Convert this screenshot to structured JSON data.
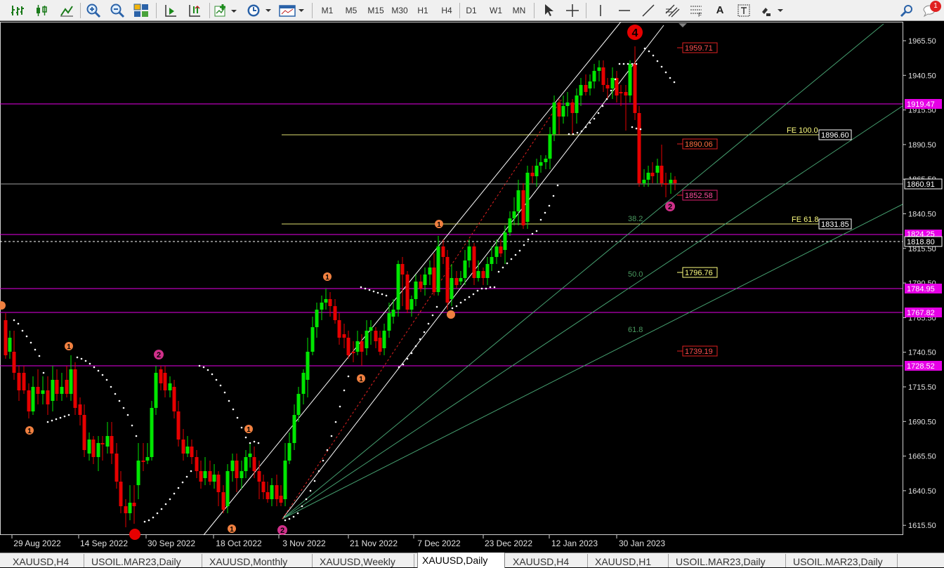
{
  "toolbar": {
    "timeframes": [
      "M1",
      "M5",
      "M15",
      "M30",
      "H1",
      "H4",
      "D1",
      "W1",
      "MN"
    ],
    "tools": {
      "bar_chart": "bar-chart-icon",
      "candle_chart": "candlestick-icon",
      "line_chart": "line-chart-icon",
      "zoom_in": "zoom-in-icon",
      "zoom_out": "zoom-out-icon",
      "tile": "tile-windows-icon",
      "autoscroll": "autoscroll-icon",
      "shift": "chart-shift-icon",
      "new_indicator": "indicator-icon",
      "periods": "clock-icon",
      "templates": "template-icon",
      "cursor": "cursor-icon",
      "crosshair": "crosshair-icon",
      "vline": "vertical-line-icon",
      "hline": "horizontal-line-icon",
      "trendline": "trendline-icon",
      "channel": "channel-icon",
      "fibo": "fibonacci-icon",
      "text": "text-icon",
      "label": "text-label-icon",
      "arrows": "arrows-icon",
      "search": "search-icon",
      "notifications": "notifications-icon"
    },
    "text_tool": "A",
    "notification_count": "1"
  },
  "chart": {
    "wave_top_label": "4",
    "price_ticks": [
      "1965.50",
      "1940.50",
      "1915.50",
      "1890.50",
      "1865.50",
      "1840.50",
      "1815.50",
      "1790.50",
      "1765.50",
      "1740.50",
      "1715.50",
      "1690.50",
      "1665.50",
      "1640.50",
      "1615.50"
    ],
    "date_ticks": [
      "29 Aug 2022",
      "14 Sep 2022",
      "30 Sep 2022",
      "18 Oct 2022",
      "3 Nov 2022",
      "21 Nov 2022",
      "7 Dec 2022",
      "23 Dec 2022",
      "12 Jan 2023",
      "30 Jan 2023"
    ],
    "axis_labels": {
      "magenta_1": "1919.47",
      "fe100": "1896.60",
      "current": "1860.91",
      "fe618": "1831.85",
      "magenta_2": "1824.25",
      "dashed": "1818.80",
      "magenta_3": "1784.95",
      "magenta_4": "1767.82",
      "magenta_5": "1728.52"
    },
    "price_labels": {
      "red_top": "1959.71",
      "red_mid": "1890.06",
      "pink_low": "1852.58",
      "yellow_mid": "1796.76",
      "red_low": "1739.19"
    },
    "fib_labels": {
      "fe100": "FE 100.0",
      "fe618": "FE 61.8",
      "f382": "38.2",
      "f500": "50.0",
      "f618": "61.8"
    },
    "wave_markers": [
      "1",
      "1",
      "2",
      "1",
      "1",
      "1",
      "1",
      "1",
      "2",
      "1",
      "2"
    ]
  },
  "tabs": [
    {
      "label": "XAUUSD,H4",
      "active": false
    },
    {
      "label": "USOIL.MAR23,Daily",
      "active": false
    },
    {
      "label": "XAUUSD,Monthly",
      "active": false
    },
    {
      "label": "XAUUSD,Weekly",
      "active": false
    },
    {
      "label": "XAUUSD,Daily",
      "active": true
    },
    {
      "label": "XAUUSD,H4",
      "active": false
    },
    {
      "label": "XAUUSD,H1",
      "active": false
    },
    {
      "label": "USOIL.MAR23,Daily",
      "active": false
    },
    {
      "label": "USOIL.MAR23,Daily",
      "active": false
    }
  ],
  "colors": {
    "bull": "#00e600",
    "bear": "#e60000",
    "magenta": "#e600e6",
    "yellow": "#ffff80",
    "fib_green": "#4a9a60",
    "axis_box": "#ffffff"
  }
}
